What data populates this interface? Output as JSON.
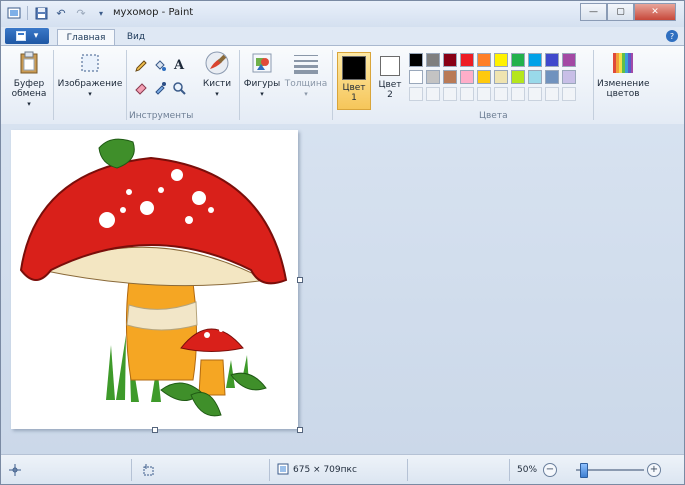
{
  "window": {
    "title": "мухомор - Paint"
  },
  "tabs": {
    "home": "Главная",
    "view": "Вид"
  },
  "ribbon": {
    "clipboard": "Буфер обмена",
    "image": "Изображение",
    "tools_group": "Инструменты",
    "brushes": "Кисти",
    "shapes": "Фигуры",
    "thickness": "Толщина",
    "color1": "Цвет 1",
    "color2": "Цвет 2",
    "colors_group": "Цвета",
    "edit_colors": "Изменение цветов"
  },
  "palette": {
    "row1": [
      "#000000",
      "#7f7f7f",
      "#880015",
      "#ed1c24",
      "#ff7f27",
      "#fff200",
      "#22b14c",
      "#00a2e8",
      "#3f48cc",
      "#a349a4"
    ],
    "row2": [
      "#ffffff",
      "#c3c3c3",
      "#b97a57",
      "#ffaec9",
      "#ffc90e",
      "#efe4b0",
      "#b5e61d",
      "#99d9ea",
      "#7092be",
      "#c8bfe7"
    ],
    "color1_value": "#000000",
    "color2_value": "#ffffff"
  },
  "status": {
    "image_size": "675 × 709пкс",
    "zoom": "50%",
    "zoom_fraction": 0.1
  },
  "icons": {
    "save": "save-icon",
    "undo": "undo-icon",
    "redo": "redo-icon"
  }
}
